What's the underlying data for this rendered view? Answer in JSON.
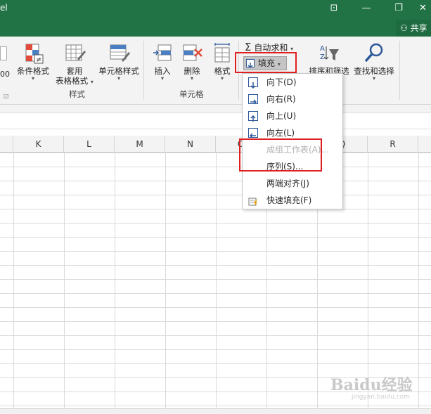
{
  "window": {
    "title_fragment": "el",
    "share_label": "共享",
    "buttons": {
      "ribbon_toggle": "⊡",
      "minimize": "—",
      "restore": "❐",
      "close": "✕"
    }
  },
  "ribbon": {
    "styles_group": {
      "label": "样式",
      "conditional_format": "条件格式",
      "format_as_table_line1": "套用",
      "format_as_table_line2": "表格格式",
      "cell_styles": "单元格样式"
    },
    "cells_group": {
      "label": "单元格",
      "insert": "插入",
      "delete": "删除",
      "format": "格式"
    },
    "editing_group": {
      "autosum": "自动求和",
      "fill": "填充",
      "sort_filter": "排序和筛选",
      "find_select": "查找和选择"
    },
    "left_fragment": "00"
  },
  "columns": [
    "K",
    "L",
    "M",
    "N",
    "O",
    "P",
    "Q",
    "R"
  ],
  "fill_menu": {
    "items": [
      {
        "label": "向下(D)",
        "icon": "arrow-down-icon",
        "enabled": true
      },
      {
        "label": "向右(R)",
        "icon": "arrow-right-icon",
        "enabled": true
      },
      {
        "label": "向上(U)",
        "icon": "arrow-up-icon",
        "enabled": true
      },
      {
        "label": "向左(L)",
        "icon": "arrow-left-icon",
        "enabled": true
      },
      {
        "label": "成组工作表(A)...",
        "icon": "",
        "enabled": false
      },
      {
        "label": "序列(S)...",
        "icon": "",
        "enabled": true
      },
      {
        "label": "两端对齐(J)",
        "icon": "",
        "enabled": true
      },
      {
        "label": "快速填充(F)",
        "icon": "flash-fill-icon",
        "enabled": true
      }
    ]
  },
  "watermark": {
    "brand": "Baidu经验",
    "url": "jingyan.baidu.com"
  },
  "colors": {
    "title_bar": "#217346",
    "highlight": "#e02020",
    "icon_blue": "#2b579a"
  }
}
